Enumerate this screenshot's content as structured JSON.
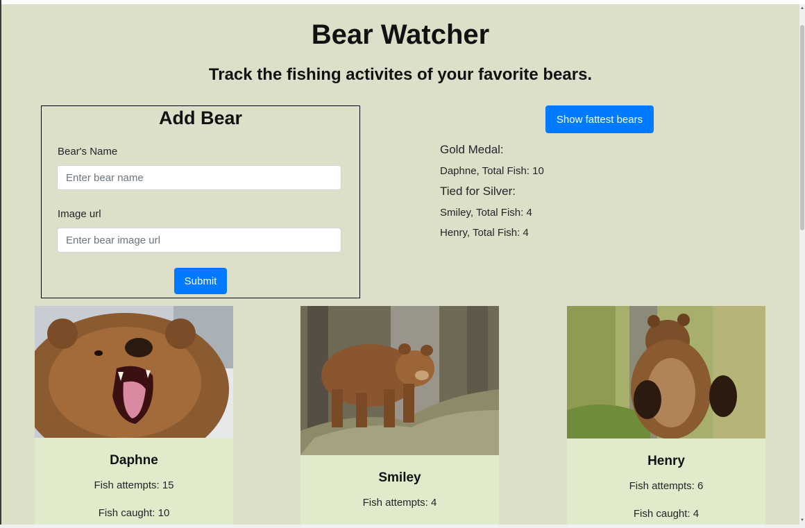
{
  "header": {
    "title": "Bear Watcher",
    "subtitle": "Track the fishing activites of your favorite bears."
  },
  "add_form": {
    "title": "Add Bear",
    "name_label": "Bear's Name",
    "name_placeholder": "Enter bear name",
    "name_value": "",
    "image_label": "Image url",
    "image_placeholder": "Enter bear image url",
    "image_value": "",
    "submit_label": "Submit"
  },
  "leaderboard": {
    "button_label": "Show fattest bears",
    "gold_heading": "Gold Medal:",
    "gold_entries": [
      "Daphne, Total Fish: 10"
    ],
    "silver_heading": "Tied for Silver:",
    "silver_entries": [
      "Smiley, Total Fish: 4",
      "Henry, Total Fish: 4"
    ]
  },
  "bears": [
    {
      "name": "Daphne",
      "attempts": "Fish attempts: 15",
      "caught": "Fish caught: 10",
      "image": "roaring-brown-bear-photo"
    },
    {
      "name": "Smiley",
      "attempts": "Fish attempts: 4",
      "caught": "",
      "image": "brown-bear-on-rock-photo"
    },
    {
      "name": "Henry",
      "attempts": "Fish attempts: 6",
      "caught": "Fish caught: 4",
      "image": "standing-brown-bear-photo"
    }
  ],
  "colors": {
    "page_bg": "#dedfc8",
    "card_bg": "#e0ebcb",
    "button": "#007bff"
  }
}
